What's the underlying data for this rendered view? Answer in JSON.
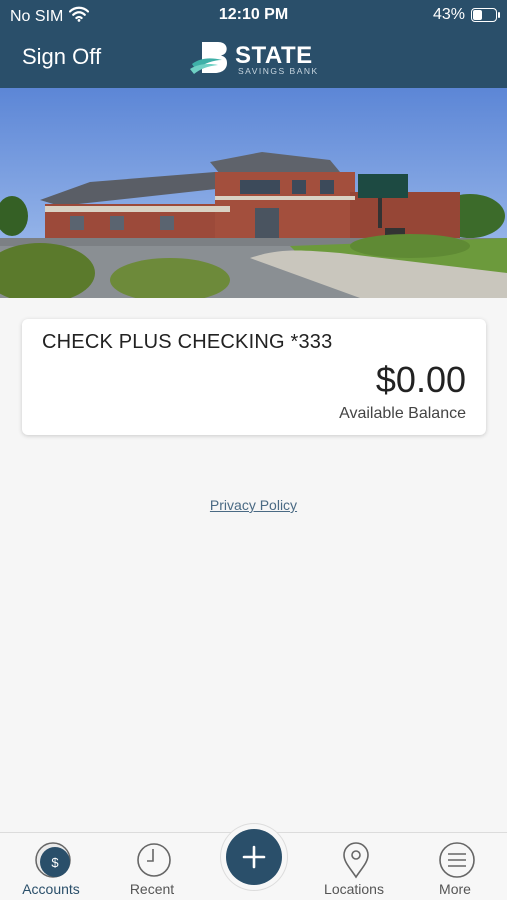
{
  "status_bar": {
    "carrier": "No SIM",
    "time": "12:10 PM",
    "battery": "43%",
    "battery_level": 0.43
  },
  "header": {
    "sign_off_label": "Sign Off",
    "logo_wordmark": "STATE",
    "logo_subtitle": "SAVINGS BANK"
  },
  "account": {
    "name": "CHECK PLUS CHECKING *333",
    "balance": "$0.00",
    "balance_label": "Available Balance"
  },
  "footer": {
    "privacy_link": "Privacy Policy"
  },
  "tabbar": {
    "accounts_label": "Accounts",
    "recent_label": "Recent",
    "locations_label": "Locations",
    "more_label": "More"
  },
  "colors": {
    "brand": "#2a4f6a",
    "background": "#f6f6f6"
  }
}
